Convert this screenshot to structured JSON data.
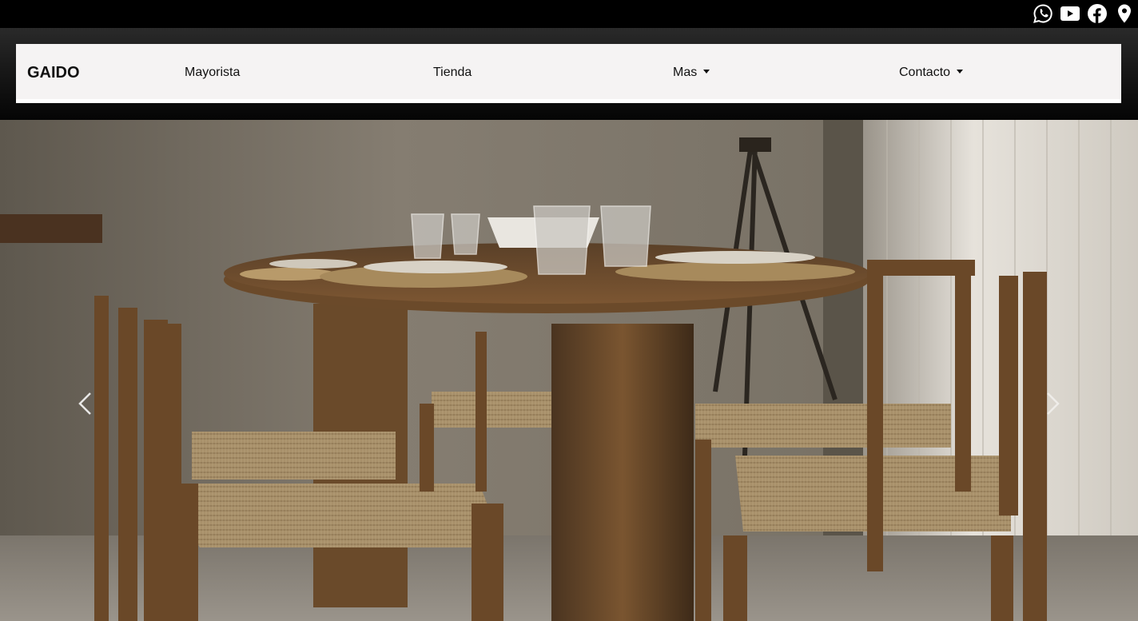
{
  "social": {
    "icons": [
      "whatsapp-icon",
      "youtube-icon",
      "facebook-icon",
      "location-pin-icon"
    ]
  },
  "navbar": {
    "brand": "GAIDO",
    "links": [
      {
        "label": "Mayorista",
        "dropdown": false
      },
      {
        "label": "Tienda",
        "dropdown": false
      },
      {
        "label": "Mas",
        "dropdown": true
      },
      {
        "label": "Contacto",
        "dropdown": true
      }
    ]
  },
  "carousel": {
    "prev_icon": "chevron-left-icon",
    "next_icon": "chevron-right-icon"
  },
  "colors": {
    "topbar": "#000000",
    "navbar_bg": "#f5f3f3",
    "text": "#111111"
  }
}
